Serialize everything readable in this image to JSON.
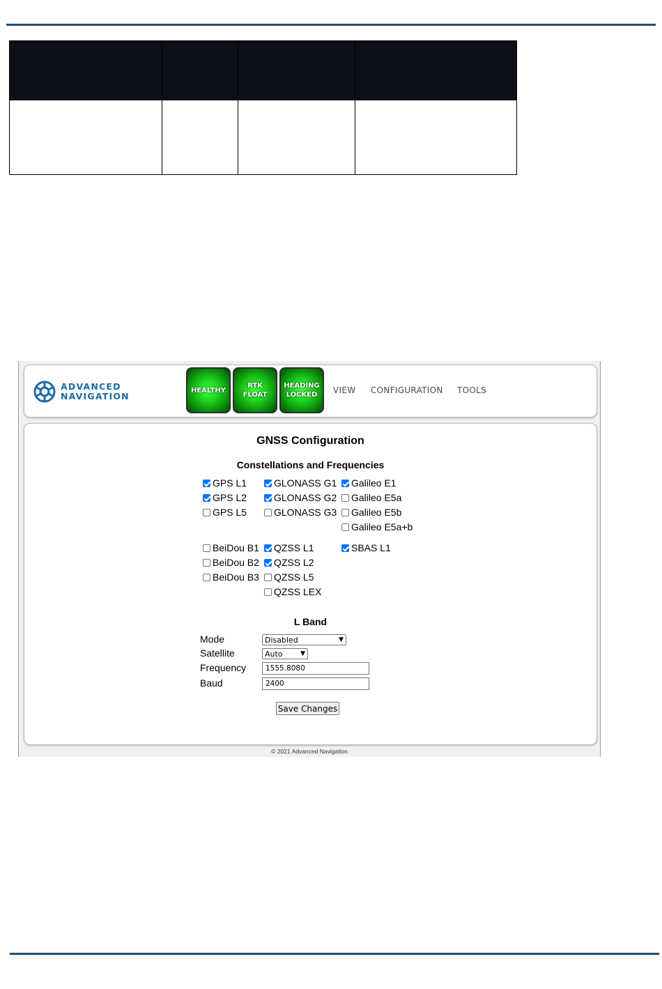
{
  "colors": {
    "rule": "#1f4e79",
    "table_header": "#0d1117",
    "brand_blue": "#1b6aa5",
    "status_green": "#1ed51e",
    "checkbox_blue": "#0075ff"
  },
  "navbar": {
    "brand_line1": "ADVANCED",
    "brand_line2": "NAVIGATION",
    "status": {
      "healthy": "HEALTHY",
      "rtk": "RTK FLOAT",
      "heading_line1": "HEADING",
      "heading_line2": "LOCKED"
    },
    "links": {
      "view": "VIEW",
      "configuration": "CONFIGURATION",
      "tools": "TOOLS"
    }
  },
  "panel": {
    "title": "GNSS Configuration",
    "constellations_title": "Constellations and Frequencies",
    "checkboxes": {
      "gps_l1": {
        "label": "GPS L1",
        "checked": true
      },
      "gps_l2": {
        "label": "GPS L2",
        "checked": true
      },
      "gps_l5": {
        "label": "GPS L5",
        "checked": false
      },
      "glonass_g1": {
        "label": "GLONASS G1",
        "checked": true
      },
      "glonass_g2": {
        "label": "GLONASS G2",
        "checked": true
      },
      "glonass_g3": {
        "label": "GLONASS G3",
        "checked": false
      },
      "galileo_e1": {
        "label": "Galileo E1",
        "checked": true
      },
      "galileo_e5a": {
        "label": "Galileo E5a",
        "checked": false
      },
      "galileo_e5b": {
        "label": "Galileo E5b",
        "checked": false
      },
      "galileo_e5ab": {
        "label": "Galileo E5a+b",
        "checked": false
      },
      "beidou_b1": {
        "label": "BeiDou B1",
        "checked": false
      },
      "beidou_b2": {
        "label": "BeiDou B2",
        "checked": false
      },
      "beidou_b3": {
        "label": "BeiDou B3",
        "checked": false
      },
      "qzss_l1": {
        "label": "QZSS L1",
        "checked": true
      },
      "qzss_l2": {
        "label": "QZSS L2",
        "checked": true
      },
      "qzss_l5": {
        "label": "QZSS L5",
        "checked": false
      },
      "qzss_lex": {
        "label": "QZSS LEX",
        "checked": false
      },
      "sbas_l1": {
        "label": "SBAS L1",
        "checked": true
      }
    },
    "lband": {
      "title": "L Band",
      "mode_label": "Mode",
      "mode_value": "Disabled",
      "satellite_label": "Satellite",
      "satellite_value": "Auto",
      "frequency_label": "Frequency",
      "frequency_value": "1555.8080",
      "baud_label": "Baud",
      "baud_value": "2400"
    },
    "save_label": "Save Changes"
  },
  "footer": "© 2021 Advanced Navigation"
}
